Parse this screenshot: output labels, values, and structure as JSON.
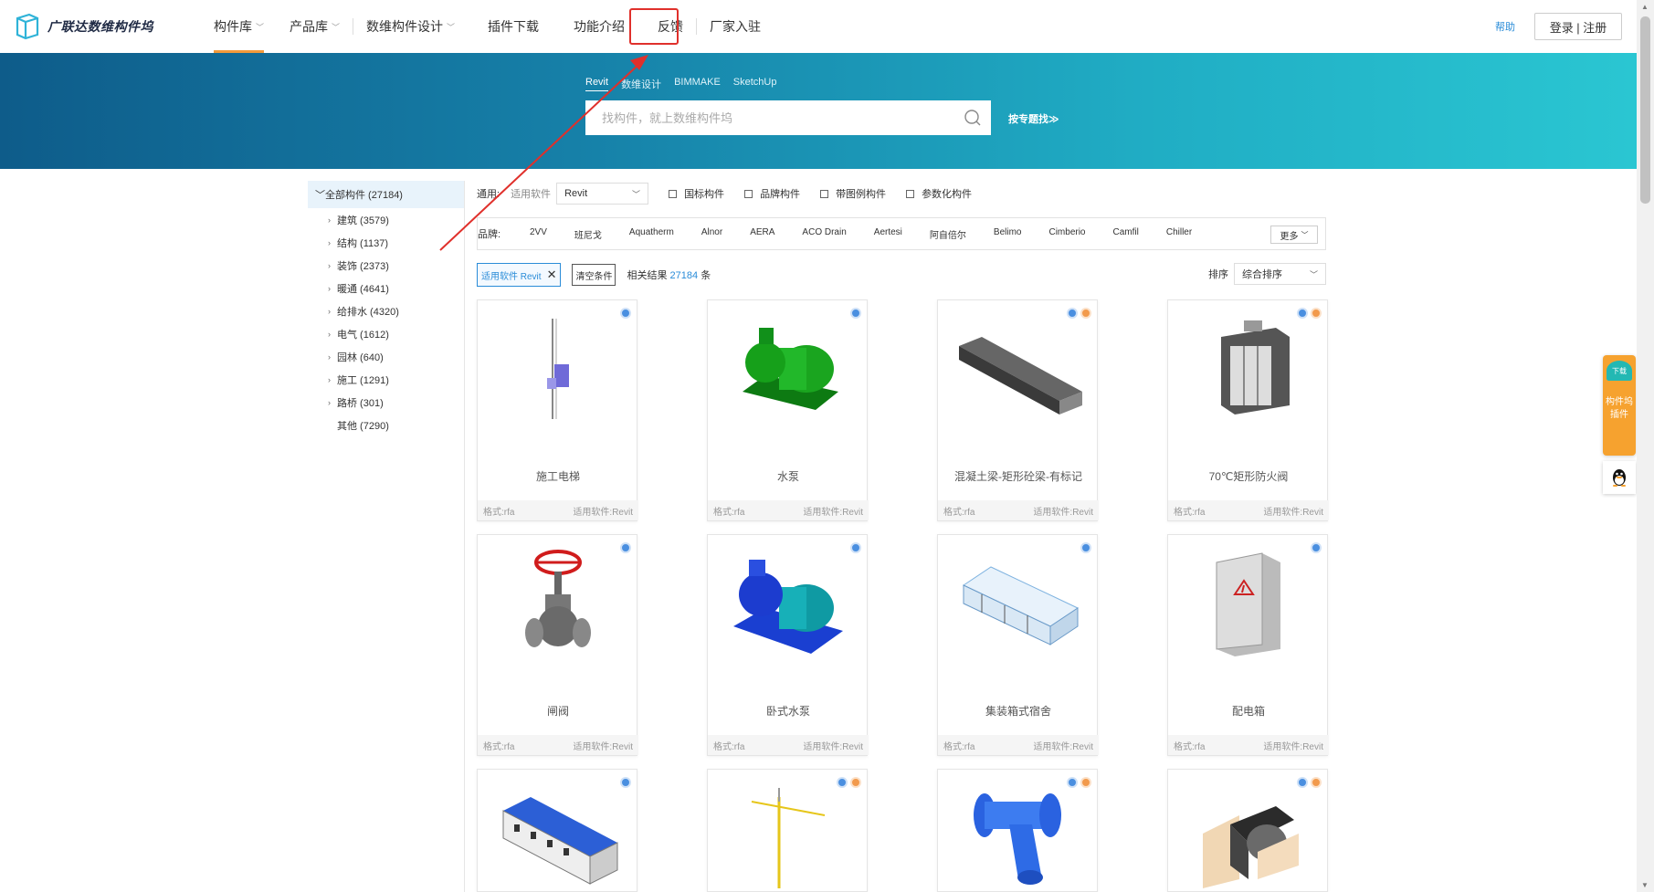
{
  "brand": {
    "logo_text": "广联达数维构件坞"
  },
  "nav": {
    "items": [
      {
        "label": "构件库",
        "dropdown": true,
        "active": true
      },
      {
        "label": "产品库",
        "dropdown": true,
        "active": false
      },
      {
        "label": "数维构件设计",
        "dropdown": true,
        "active": false
      },
      {
        "label": "插件下载",
        "dropdown": false,
        "active": false
      },
      {
        "label": "功能介绍",
        "dropdown": false,
        "active": false
      },
      {
        "label": "反馈",
        "dropdown": false,
        "active": false
      },
      {
        "label": "厂家入驻",
        "dropdown": false,
        "active": false
      }
    ],
    "help": "帮助",
    "login": "登录 | 注册"
  },
  "search": {
    "tabs": [
      "Revit",
      "数维设计",
      "BIMMAKE",
      "SketchUp"
    ],
    "active_tab": "Revit",
    "placeholder": "找构件，就上数维构件坞",
    "topic_link": "按专题找≫"
  },
  "sidebar": {
    "root": "全部构件 (27184)",
    "items": [
      {
        "label": "建筑 (3579)",
        "arrow": true
      },
      {
        "label": "结构 (1137)",
        "arrow": true
      },
      {
        "label": "装饰 (2373)",
        "arrow": true
      },
      {
        "label": "暖通 (4641)",
        "arrow": true
      },
      {
        "label": "给排水 (4320)",
        "arrow": true
      },
      {
        "label": "电气 (1612)",
        "arrow": true
      },
      {
        "label": "园林 (640)",
        "arrow": true
      },
      {
        "label": "施工 (1291)",
        "arrow": true
      },
      {
        "label": "路桥 (301)",
        "arrow": true
      },
      {
        "label": "其他 (7290)",
        "arrow": false
      }
    ]
  },
  "filters": {
    "general_label": "通用:",
    "software_label": "适用软件",
    "software_value": "Revit",
    "checkboxes": [
      "国标构件",
      "品牌构件",
      "带图例构件",
      "参数化构件"
    ],
    "brand_label": "品牌:",
    "brands": [
      "2VV",
      "班尼戈",
      "Aquatherm",
      "Alnor",
      "AERA",
      "ACO Drain",
      "Aertesi",
      "阿自倍尔",
      "Belimo",
      "Cimberio",
      "Camfil",
      "Chiller"
    ],
    "more": "更多"
  },
  "conditions": {
    "tag": "适用软件 Revit",
    "clear": "清空条件",
    "result_prefix": "相关结果",
    "result_count": "27184",
    "result_suffix": "条",
    "sort_label": "排序",
    "sort_value": "综合排序"
  },
  "cards": [
    {
      "name": "施工电梯",
      "format": "格式:rfa",
      "software": "适用软件:Revit",
      "badges": [
        "blue"
      ],
      "icon": "construction-elevator"
    },
    {
      "name": "水泵",
      "format": "格式:rfa",
      "software": "适用软件:Revit",
      "badges": [
        "blue"
      ],
      "icon": "water-pump"
    },
    {
      "name": "混凝土梁-矩形砼梁-有标记",
      "format": "格式:rfa",
      "software": "适用软件:Revit",
      "badges": [
        "blue",
        "orange"
      ],
      "icon": "concrete-beam"
    },
    {
      "name": "70℃矩形防火阀",
      "format": "格式:rfa",
      "software": "适用软件:Revit",
      "badges": [
        "blue",
        "orange"
      ],
      "icon": "fire-damper"
    },
    {
      "name": "闸阀",
      "format": "格式:rfa",
      "software": "适用软件:Revit",
      "badges": [
        "blue"
      ],
      "icon": "gate-valve"
    },
    {
      "name": "卧式水泵",
      "format": "格式:rfa",
      "software": "适用软件:Revit",
      "badges": [
        "blue"
      ],
      "icon": "horizontal-pump"
    },
    {
      "name": "集装箱式宿舍",
      "format": "格式:rfa",
      "software": "适用软件:Revit",
      "badges": [
        "blue"
      ],
      "icon": "container-dorm"
    },
    {
      "name": "配电箱",
      "format": "格式:rfa",
      "software": "适用软件:Revit",
      "badges": [
        "blue"
      ],
      "icon": "distribution-box"
    },
    {
      "name": "",
      "format": "",
      "software": "",
      "badges": [
        "blue"
      ],
      "icon": "dormitory-building"
    },
    {
      "name": "",
      "format": "",
      "software": "",
      "badges": [
        "blue",
        "orange"
      ],
      "icon": "tower-crane"
    },
    {
      "name": "",
      "format": "",
      "software": "",
      "badges": [
        "blue",
        "orange"
      ],
      "icon": "y-strainer"
    },
    {
      "name": "",
      "format": "",
      "software": "",
      "badges": [
        "blue",
        "orange"
      ],
      "icon": "duct-fitting"
    }
  ],
  "float": {
    "dl_badge": "下载",
    "dl_text_1": "构件坞",
    "dl_text_2": "插件"
  },
  "colors": {
    "accent": "#f39a3b",
    "link": "#2a8cd8",
    "annotation": "#e0302b"
  }
}
